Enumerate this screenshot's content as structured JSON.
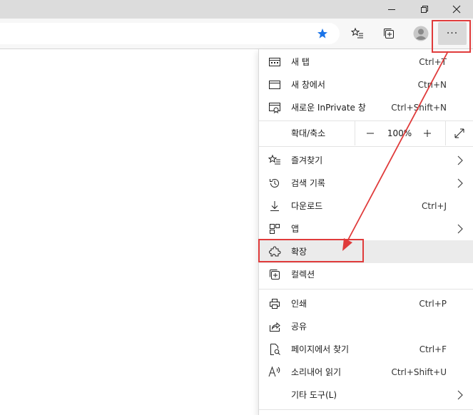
{
  "window": {
    "minimize_icon": "minimize-icon",
    "restore_icon": "restore-icon",
    "close_icon": "close-icon"
  },
  "toolbar": {
    "favorite_star_color": "#1a73e8",
    "more_label": "···"
  },
  "menu": {
    "items": [
      {
        "label": "새 탭",
        "shortcut": "Ctrl+T",
        "icon": "new-tab-icon"
      },
      {
        "label": "새 창에서",
        "shortcut": "Ctrl+N",
        "icon": "new-window-icon"
      },
      {
        "label": "새로운 InPrivate 창",
        "shortcut": "Ctrl+Shift+N",
        "icon": "inprivate-window-icon"
      }
    ],
    "zoom": {
      "label": "확대/축소",
      "minus": "—",
      "value": "100%",
      "plus": "+"
    },
    "items2": [
      {
        "label": "즐겨찾기",
        "icon": "favorites-icon"
      },
      {
        "label": "검색 기록",
        "icon": "history-icon"
      },
      {
        "label": "다운로드",
        "shortcut": "Ctrl+J",
        "icon": "download-icon"
      },
      {
        "label": "앱",
        "icon": "apps-icon"
      },
      {
        "label": "확장",
        "icon": "extensions-icon"
      },
      {
        "label": "컬렉션",
        "icon": "collections-icon"
      }
    ],
    "items3": [
      {
        "label": "인쇄",
        "shortcut": "Ctrl+P",
        "icon": "print-icon"
      },
      {
        "label": "공유",
        "icon": "share-icon"
      },
      {
        "label": "페이지에서 찾기",
        "shortcut": "Ctrl+F",
        "icon": "find-icon"
      },
      {
        "label": "소리내어 읽기",
        "shortcut": "Ctrl+Shift+U",
        "icon": "read-aloud-icon"
      },
      {
        "label": "기타 도구(L)",
        "icon": "more-tools-icon"
      }
    ]
  },
  "annotation": {
    "highlight_color": "#e03b3b"
  }
}
